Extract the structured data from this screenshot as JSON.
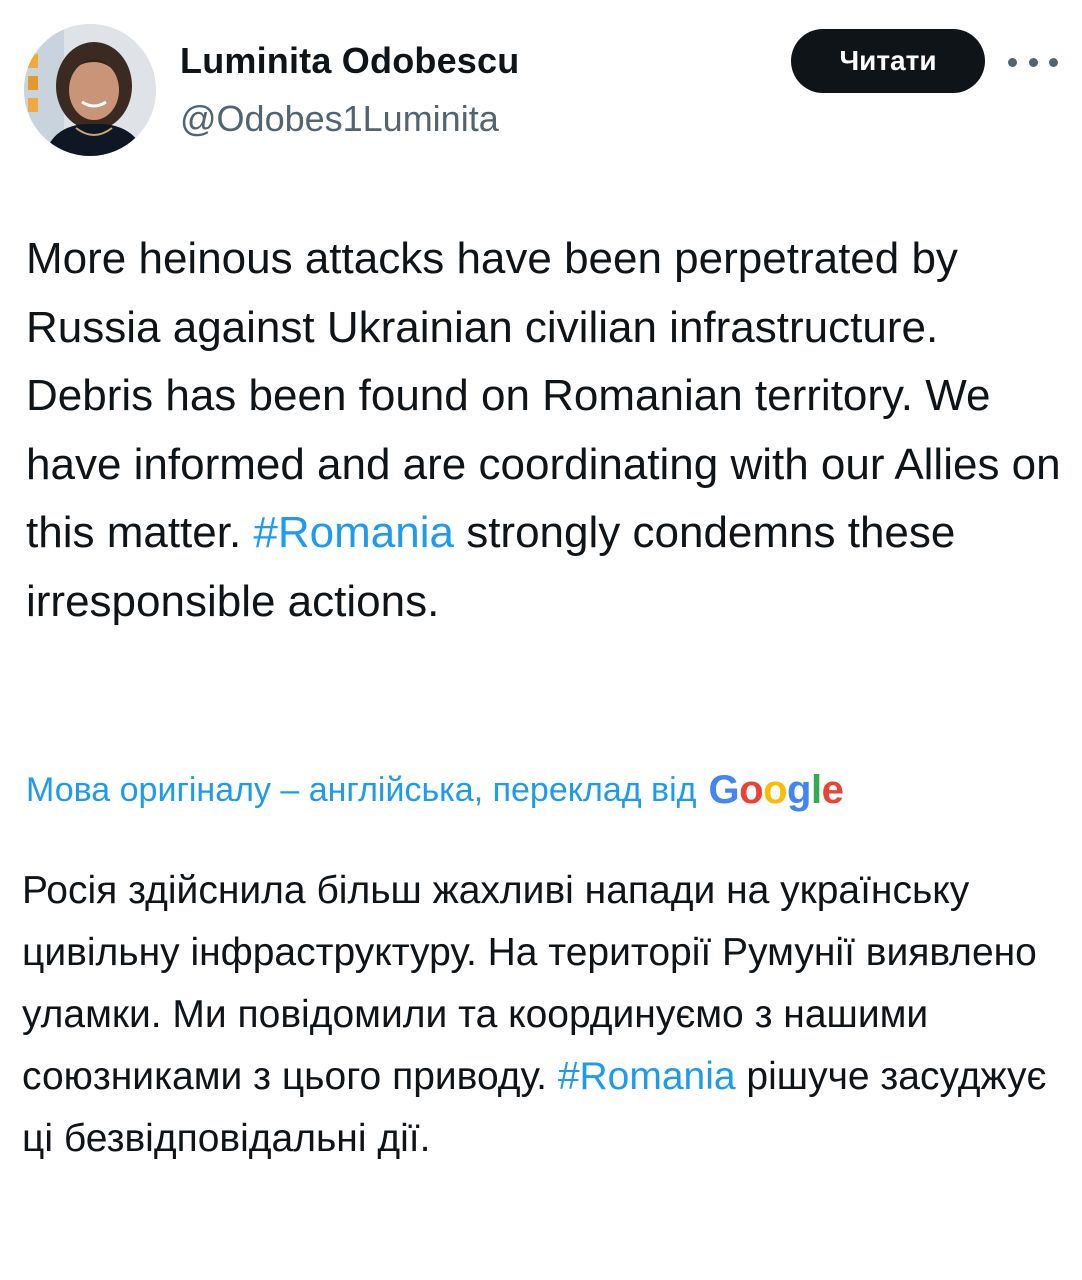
{
  "author": {
    "name": "Luminita Odobescu",
    "handle": "@Odobes1Luminita"
  },
  "actions": {
    "read_label": "Читати",
    "more_icon": "more-horizontal-icon"
  },
  "tweet": {
    "text_before_hashtag": "More heinous attacks have been perpetrated by Russia against Ukrainian civilian infrastructure. Debris has been found on Romanian territory. We have informed and are coordinating with our Allies on this matter. ",
    "hashtag": "#Romania",
    "text_after_hashtag": " strongly condemns these irresponsible actions."
  },
  "translation": {
    "note": "Мова оригіналу – англійська, переклад від",
    "provider": "Google",
    "provider_colors": [
      "#4285F4",
      "#EA4335",
      "#FBBC05",
      "#4285F4",
      "#34A853",
      "#EA4335"
    ],
    "text_before_hashtag": "Росія здійснила більш жахливі напади на українську цивільну інфраструктуру. На території Румунії виявлено уламки. Ми повідомили та координуємо з нашими союзниками з цього приводу. ",
    "hashtag": "#Romania",
    "text_after_hashtag": " рішуче засуджує ці безвідповідальні дії."
  },
  "colors": {
    "link": "#1d9bf0",
    "text": "#0f1419",
    "secondary": "#536471",
    "button_bg": "#0f1419"
  }
}
